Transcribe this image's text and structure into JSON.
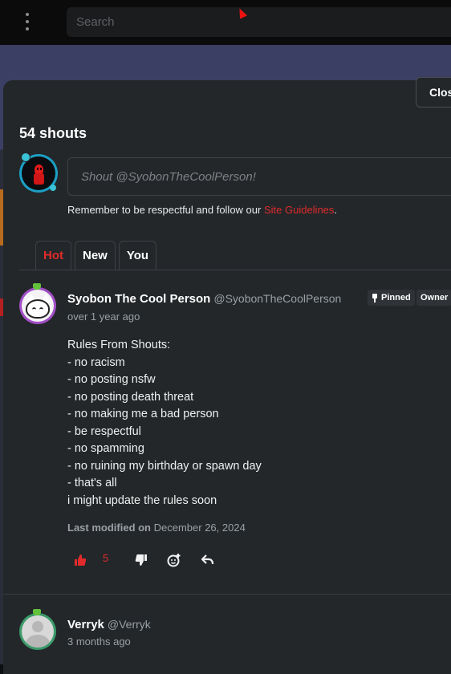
{
  "topbar": {
    "search_placeholder": "Search"
  },
  "modal": {
    "close_label": "Close",
    "count_label": "54 shouts",
    "input_placeholder": "Shout @SyobonTheCoolPerson!",
    "reminder_prefix": "Remember to be respectful and follow our ",
    "reminder_link": "Site Guidelines",
    "reminder_suffix": ".",
    "tabs": [
      {
        "label": "Hot",
        "active": true
      },
      {
        "label": "New",
        "active": false
      },
      {
        "label": "You",
        "active": false
      }
    ]
  },
  "posts": [
    {
      "author": "Syobon The Cool Person",
      "handle": "@SyobonTheCoolPerson",
      "time": "over 1 year ago",
      "tags": [
        "Pinned",
        "Owner"
      ],
      "body": "Rules From Shouts:\n- no racism\n- no posting nsfw\n- no posting death threat\n- no making me a bad person\n- be respectful\n- no spamming\n- no ruining my birthday or spawn day\n- that's all\ni might update the rules soon",
      "modified_label": "Last modified on",
      "modified_date": "December 26, 2024",
      "likes": "5"
    },
    {
      "author": "Verryk",
      "handle": "@Verryk",
      "time": "3 months ago"
    }
  ],
  "colors": {
    "accent": "#e12b2b",
    "panel": "#23272a",
    "badge": "#63c23b"
  },
  "icons": [
    "kebab-menu-icon",
    "pin-icon",
    "thumbs-up-icon",
    "thumbs-down-icon",
    "add-reaction-icon",
    "reply-icon"
  ]
}
